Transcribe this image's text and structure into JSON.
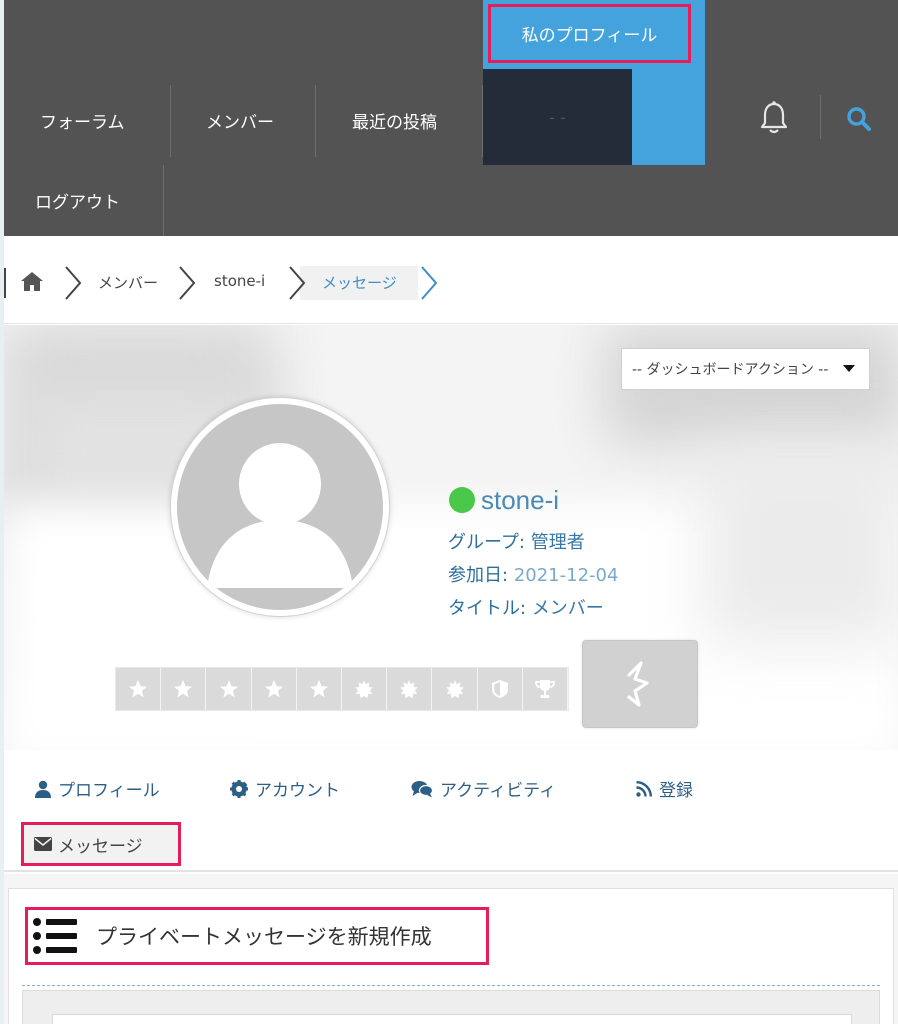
{
  "nav": {
    "items": [
      {
        "label": "フォーラム"
      },
      {
        "label": "メンバー"
      },
      {
        "label": "最近の投稿"
      },
      {
        "label": "ログアウト"
      }
    ],
    "my_profile": "私のプロフィール",
    "hidden_item": "- -",
    "bell_icon": "bell-icon",
    "search_icon": "search-icon"
  },
  "breadcrumb": {
    "home_icon": "home-icon",
    "items": [
      {
        "label": "メンバー"
      },
      {
        "label": "stone-i"
      },
      {
        "label": "メッセージ"
      }
    ]
  },
  "profile": {
    "dashboard_action": "-- ダッシュボードアクション --",
    "username": "stone-i",
    "online": true,
    "group_key": "グループ:",
    "group_value": "管理者",
    "joined_key": "参加日:",
    "joined_value": "2021-12-04",
    "title_key": "タイトル:",
    "title_value": "メンバー",
    "badges": [
      "star-icon",
      "star-icon",
      "star-icon",
      "star-icon",
      "star-icon",
      "sun-icon",
      "sun-icon",
      "sun-icon",
      "shield-icon",
      "trophy-icon"
    ]
  },
  "tabs": {
    "items": [
      {
        "label": "プロフィール",
        "icon": "user-icon"
      },
      {
        "label": "アカウント",
        "icon": "gear-icon"
      },
      {
        "label": "アクティビティ",
        "icon": "comments-icon"
      },
      {
        "label": "登録",
        "icon": "rss-icon"
      },
      {
        "label": "メッセージ",
        "icon": "envelope-icon"
      }
    ]
  },
  "content": {
    "compose_title": "プライベートメッセージを新規作成"
  },
  "colors": {
    "nav_bg": "#535353",
    "accent_blue": "#44a3dd",
    "highlight_red": "#e51d5b",
    "link_blue": "#2d5f85",
    "online_green": "#4ac84a"
  }
}
